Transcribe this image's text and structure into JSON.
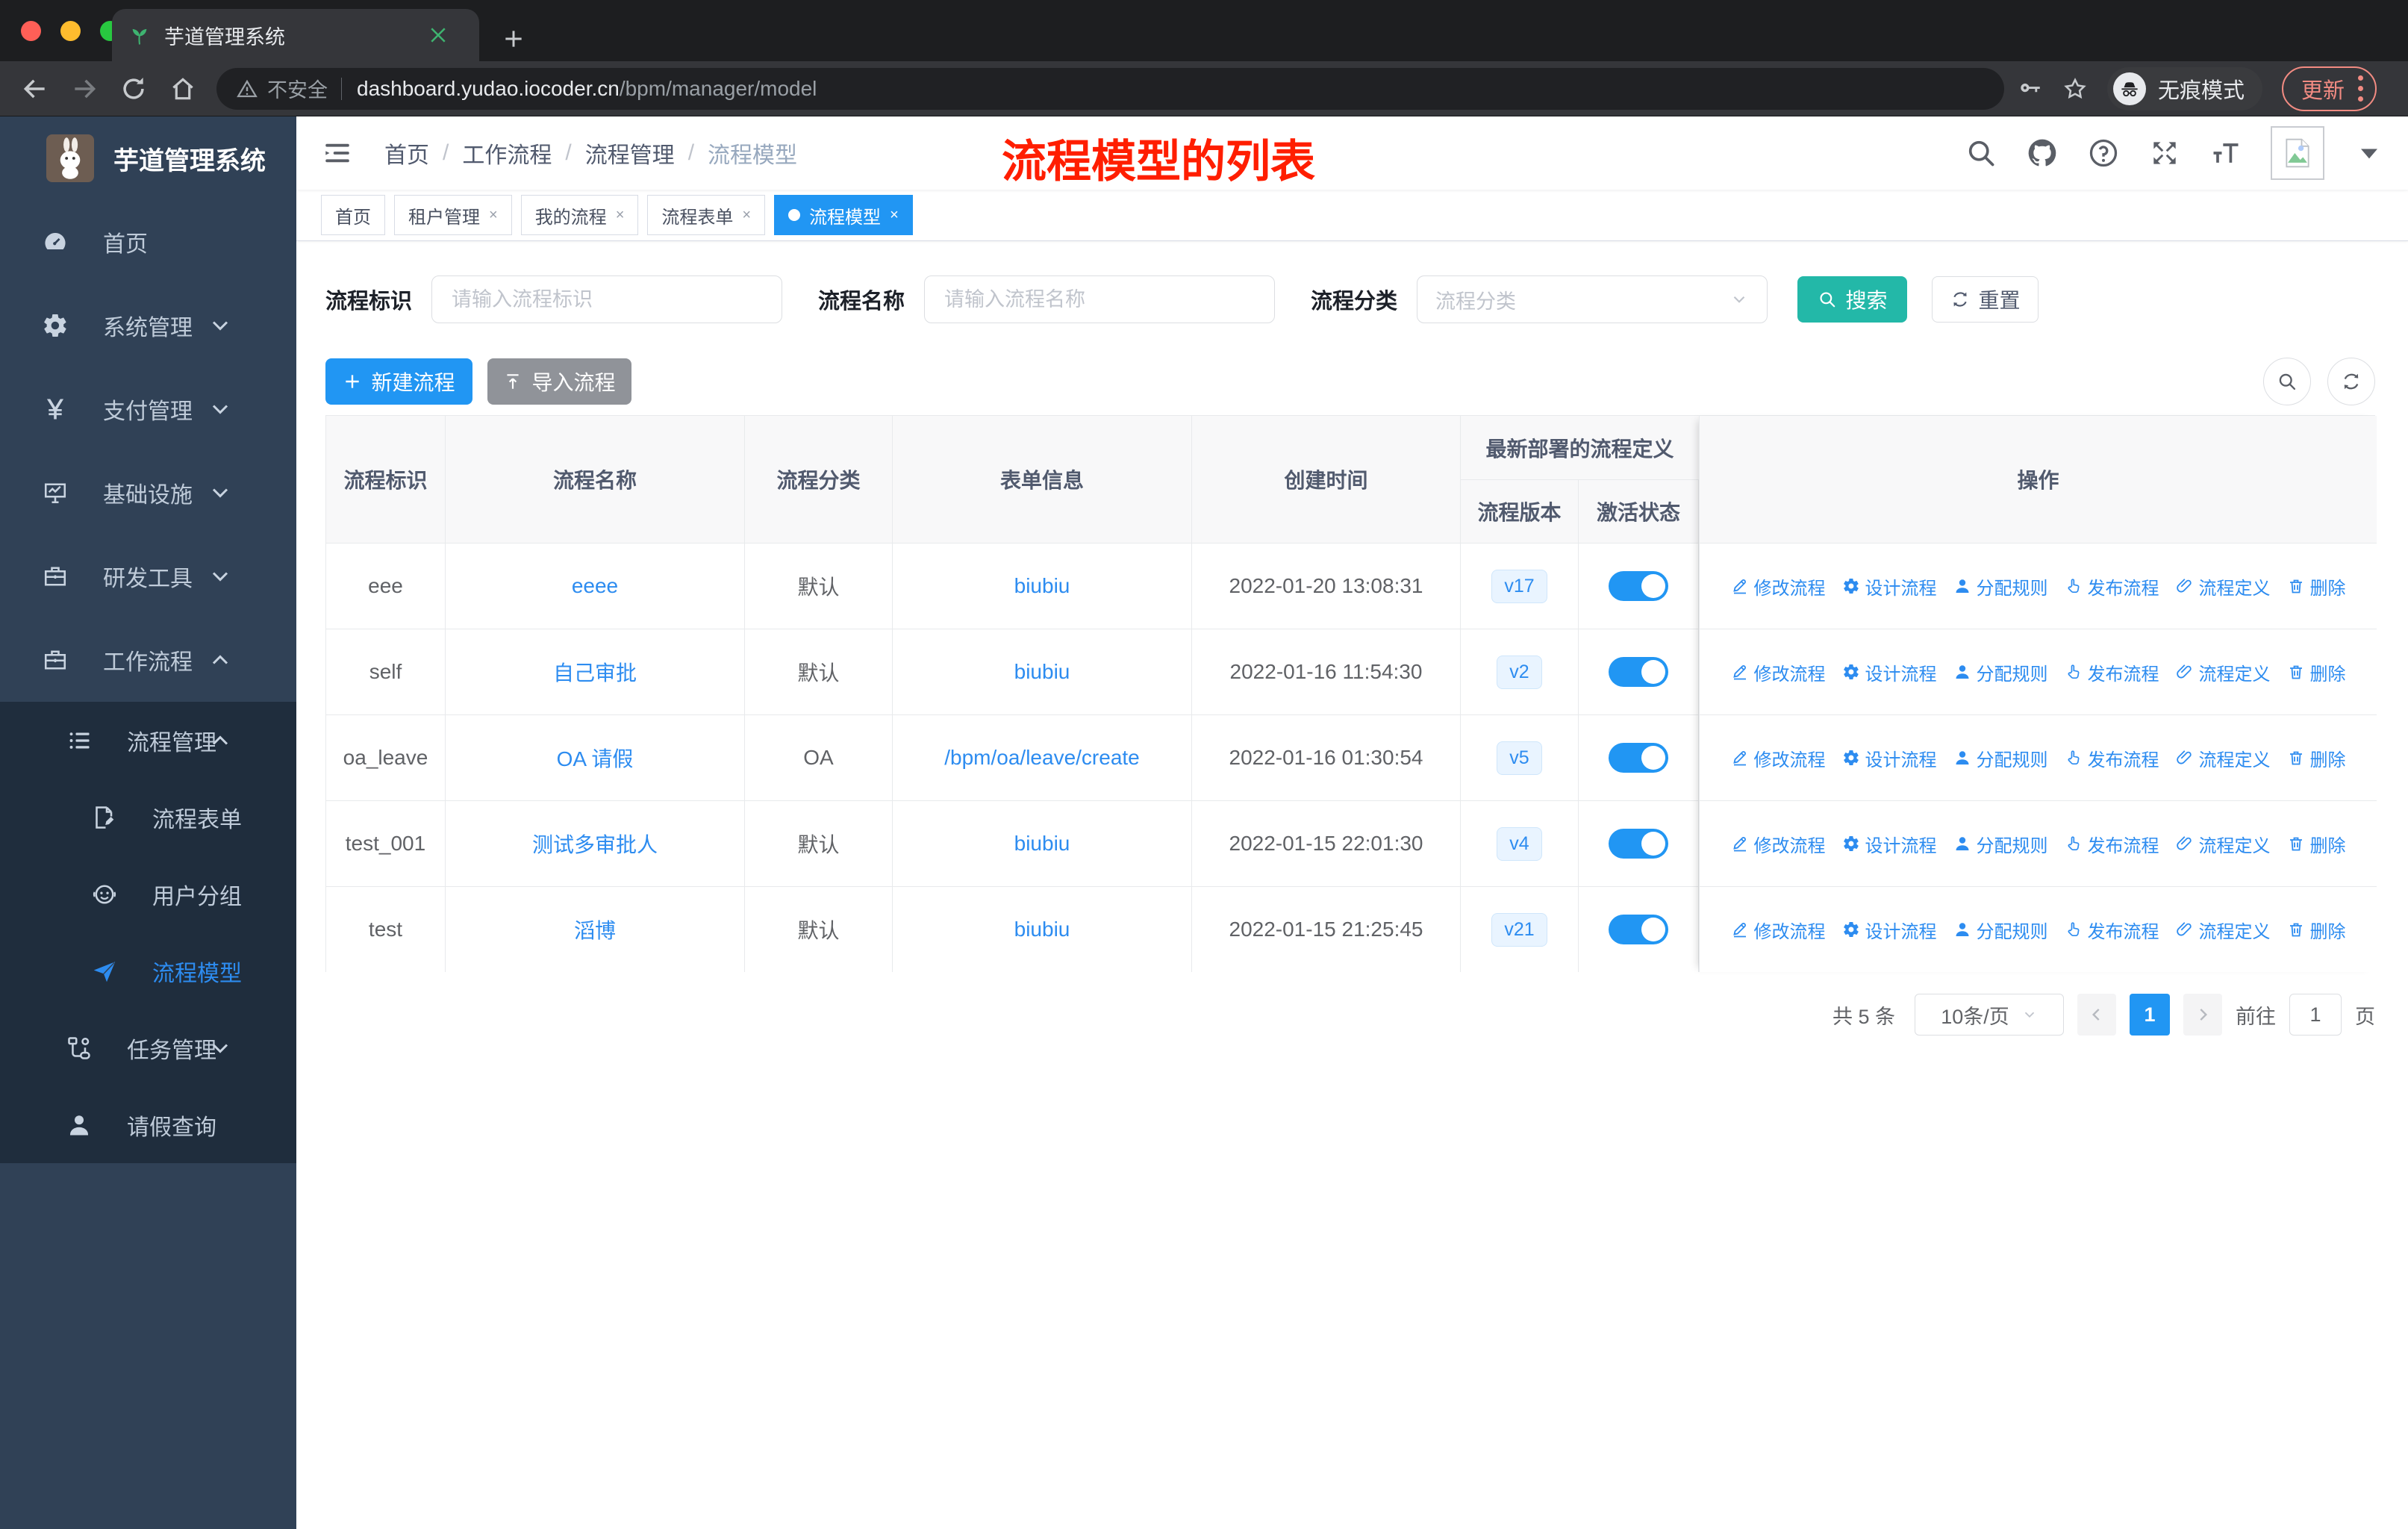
{
  "browser": {
    "tab_title": "芋道管理系统",
    "security_label": "不安全",
    "url_host": "dashboard.yudao.iocoder.cn",
    "url_path": "/bpm/manager/model",
    "incognito_label": "无痕模式",
    "update_label": "更新"
  },
  "sidebar": {
    "logo_title": "芋道管理系统",
    "items": [
      {
        "label": "首页",
        "icon": "dashboard",
        "level": 1,
        "chevron": null,
        "dark": false,
        "active": false
      },
      {
        "label": "系统管理",
        "icon": "gear",
        "level": 1,
        "chevron": "down",
        "dark": false,
        "active": false
      },
      {
        "label": "支付管理",
        "icon": "yen",
        "level": 1,
        "chevron": "down",
        "dark": false,
        "active": false
      },
      {
        "label": "基础设施",
        "icon": "monitor",
        "level": 1,
        "chevron": "down",
        "dark": false,
        "active": false
      },
      {
        "label": "研发工具",
        "icon": "briefcase",
        "level": 1,
        "chevron": "down",
        "dark": false,
        "active": false
      },
      {
        "label": "工作流程",
        "icon": "briefcase",
        "level": 1,
        "chevron": "up",
        "dark": false,
        "active": false
      },
      {
        "label": "流程管理",
        "icon": "list",
        "level": 2,
        "chevron": "up",
        "dark": true,
        "active": false
      },
      {
        "label": "流程表单",
        "icon": "form",
        "level": 3,
        "chevron": null,
        "dark": true,
        "active": false
      },
      {
        "label": "用户分组",
        "icon": "face",
        "level": 3,
        "chevron": null,
        "dark": true,
        "active": false
      },
      {
        "label": "流程模型",
        "icon": "send",
        "level": 3,
        "chevron": null,
        "dark": true,
        "active": true
      },
      {
        "label": "任务管理",
        "icon": "flow",
        "level": 2,
        "chevron": "down",
        "dark": true,
        "active": false
      },
      {
        "label": "请假查询",
        "icon": "person",
        "level": 2,
        "chevron": null,
        "dark": true,
        "active": false
      }
    ]
  },
  "navbar": {
    "breadcrumb": [
      "首页",
      "工作流程",
      "流程管理",
      "流程模型"
    ],
    "annotation": "流程模型的列表"
  },
  "tags": [
    {
      "label": "首页",
      "closable": false,
      "active": false
    },
    {
      "label": "租户管理",
      "closable": true,
      "active": false
    },
    {
      "label": "我的流程",
      "closable": true,
      "active": false
    },
    {
      "label": "流程表单",
      "closable": true,
      "active": false
    },
    {
      "label": "流程模型",
      "closable": true,
      "active": true
    }
  ],
  "filters": {
    "id_label": "流程标识",
    "id_placeholder": "请输入流程标识",
    "name_label": "流程名称",
    "name_placeholder": "请输入流程名称",
    "category_label": "流程分类",
    "category_placeholder": "流程分类",
    "search_label": "搜索",
    "reset_label": "重置"
  },
  "toolbar": {
    "create_label": "新建流程",
    "import_label": "导入流程"
  },
  "table": {
    "headers": {
      "id": "流程标识",
      "name": "流程名称",
      "category": "流程分类",
      "form": "表单信息",
      "created": "创建时间",
      "deploy_group": "最新部署的流程定义",
      "version": "流程版本",
      "active": "激活状态",
      "actions": "操作"
    },
    "rows": [
      {
        "id": "eee",
        "name": "eeee",
        "category": "默认",
        "form": "biubiu",
        "created": "2022-01-20 13:08:31",
        "version": "v17",
        "active": true
      },
      {
        "id": "self",
        "name": "自己审批",
        "category": "默认",
        "form": "biubiu",
        "created": "2022-01-16 11:54:30",
        "version": "v2",
        "active": true
      },
      {
        "id": "oa_leave",
        "name": "OA 请假",
        "category": "OA",
        "form": "/bpm/oa/leave/create",
        "created": "2022-01-16 01:30:54",
        "version": "v5",
        "active": true
      },
      {
        "id": "test_001",
        "name": "测试多审批人",
        "category": "默认",
        "form": "biubiu",
        "created": "2022-01-15 22:01:30",
        "version": "v4",
        "active": true
      },
      {
        "id": "test",
        "name": "滔博",
        "category": "默认",
        "form": "biubiu",
        "created": "2022-01-15 21:25:45",
        "version": "v21",
        "active": true
      }
    ],
    "actions": [
      {
        "name": "edit",
        "label": "修改流程"
      },
      {
        "name": "design",
        "label": "设计流程"
      },
      {
        "name": "assign",
        "label": "分配规则"
      },
      {
        "name": "publish",
        "label": "发布流程"
      },
      {
        "name": "definition",
        "label": "流程定义"
      },
      {
        "name": "delete",
        "label": "删除"
      }
    ]
  },
  "pagination": {
    "total": "共 5 条",
    "page_size": "10条/页",
    "current": "1",
    "goto_label": "前往",
    "goto_value": "1",
    "page_unit": "页"
  },
  "colors": {
    "accent": "#2196f3",
    "teal": "#23b8a8",
    "sidebar": "#304156",
    "sidebar_sub": "#1f2d3d",
    "annotation_red": "#ff1e00",
    "tag_active": "#2196f3"
  }
}
